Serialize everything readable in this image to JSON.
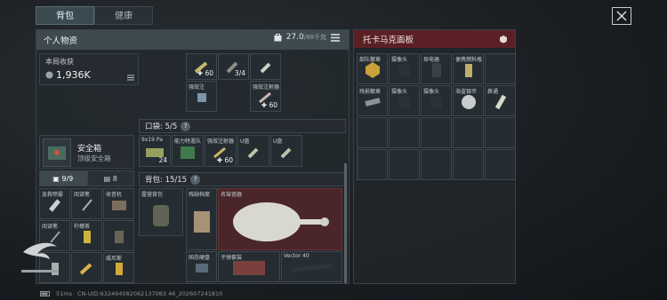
{
  "tabs": [
    "背包",
    "健康"
  ],
  "personal": {
    "title": "个人物资",
    "weight": "27.0",
    "weight_max": "/88千克"
  },
  "loot": {
    "label": "本局收获",
    "value": "1,936K"
  },
  "safebox": {
    "title": "安全箱",
    "subtitle": "顶级安全箱"
  },
  "sidebar_tabs": [
    "9/9",
    "8"
  ],
  "upper_items": [
    {
      "label": "",
      "count": "60",
      "plus": true
    },
    {
      "label": "",
      "count": "3/4",
      "plus": false
    },
    {
      "label": "",
      "count": "",
      "plus": false
    },
    {
      "label": "强效注",
      "count": "",
      "plus": false
    },
    {
      "label": "强效注射器",
      "count": "60",
      "plus": true
    }
  ],
  "pocket": {
    "title": "口袋: 5/5",
    "items": [
      {
        "label": "9x19 Pa",
        "count": "24"
      },
      {
        "label": "能力特遣队",
        "count": ""
      },
      {
        "label": "强效注射器",
        "count": "60"
      },
      {
        "label": "U盘",
        "count": ""
      },
      {
        "label": "U盘",
        "count": ""
      }
    ]
  },
  "backpack": {
    "title": "背包: 15/15",
    "bag_label": "露营背包",
    "items": [
      {
        "label": "残缺档案"
      },
      {
        "label": "名窑瓷器"
      },
      {
        "label": "固态硬盘"
      },
      {
        "label": "子弹套装"
      },
      {
        "label": "Vector 40"
      }
    ]
  },
  "left_grid": [
    {
      "label": "急救喷雾"
    },
    {
      "label": "阅读笔"
    },
    {
      "label": "收音机"
    },
    {
      "label": "阅读笔"
    },
    {
      "label": "柠檬茶"
    },
    {
      "label": ""
    },
    {
      "label": ""
    },
    {
      "label": ""
    },
    {
      "label": "威尼斯"
    }
  ],
  "tokamak": {
    "title": "托卡马克面板",
    "items": [
      {
        "label": "部队徽章"
      },
      {
        "label": "摄像头"
      },
      {
        "label": "探电器"
      },
      {
        "label": "便携燃料瓶"
      },
      {
        "label": ""
      },
      {
        "label": "残损徽章"
      },
      {
        "label": "摄像头"
      },
      {
        "label": "摄像头"
      },
      {
        "label": "海盗银币"
      },
      {
        "label": "鼻通"
      }
    ]
  },
  "status": {
    "ping": "51ms",
    "uid": "CN-UID:632464082062137083 46_202607241810"
  },
  "colors": {
    "accent_red": "#5a2026",
    "panel": "#3e4a4f"
  }
}
